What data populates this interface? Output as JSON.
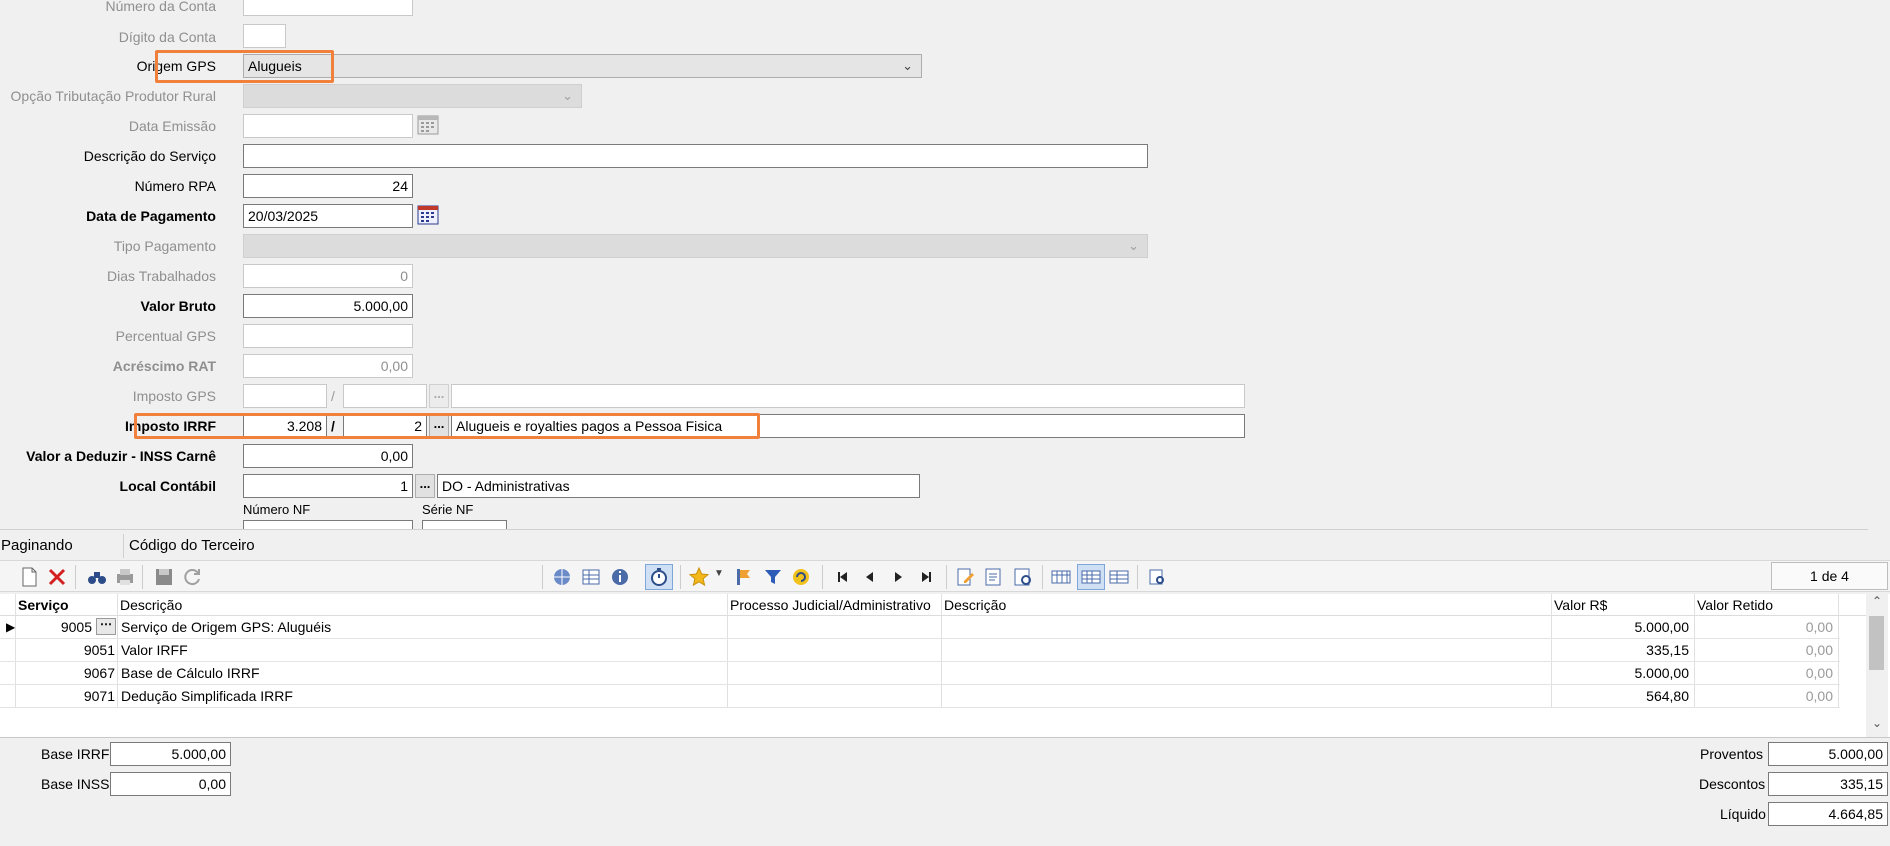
{
  "form": {
    "numero_conta_label": "Número da Conta",
    "digito_conta_label": "Dígito da Conta",
    "origem_gps_label": "Origem GPS",
    "origem_gps_value": "Alugueis",
    "opcao_tributacao_label": "Opção Tributação Produtor Rural",
    "data_emissao_label": "Data Emissão",
    "descricao_servico_label": "Descrição do Serviço",
    "numero_rpa_label": "Número RPA",
    "numero_rpa_value": "24",
    "data_pagamento_label": "Data de Pagamento",
    "data_pagamento_value": "20/03/2025",
    "tipo_pagamento_label": "Tipo Pagamento",
    "dias_trabalhados_label": "Dias Trabalhados",
    "dias_trabalhados_value": "0",
    "valor_bruto_label": "Valor Bruto",
    "valor_bruto_value": "5.000,00",
    "percentual_gps_label": "Percentual GPS",
    "acrescimo_rat_label": "Acréscimo RAT",
    "acrescimo_rat_value": "0,00",
    "imposto_gps_label": "Imposto GPS",
    "slash": "/",
    "imposto_irrf_label": "Imposto IRRF",
    "imposto_irrf_code": "3.208",
    "imposto_irrf_variation": "2",
    "imposto_irrf_desc": "Alugueis e royalties pagos a Pessoa Fisica",
    "valor_deduzir_label": "Valor a Deduzir - INSS Carnê",
    "valor_deduzir_value": "0,00",
    "local_contabil_label": "Local Contábil",
    "local_contabil_code": "1",
    "local_contabil_desc": "DO - Administrativas",
    "numero_nf_label": "Número NF",
    "serie_nf_label": "Série NF",
    "dots": "..."
  },
  "paging": {
    "label": "Paginando",
    "field": "Código do Terceiro",
    "counter": "1 de 4"
  },
  "grid": {
    "columns": [
      "Serviço",
      "Descrição",
      "Processo Judicial/Administrativo",
      "Descrição",
      "Valor R$",
      "Valor Retido"
    ],
    "rows": [
      {
        "servico": "9005",
        "descricao": "Serviço de Origem GPS: Aluguéis",
        "processo": "",
        "descricao2": "",
        "valor": "5.000,00",
        "retido": "0,00"
      },
      {
        "servico": "9051",
        "descricao": "Valor IRFF",
        "processo": "",
        "descricao2": "",
        "valor": "335,15",
        "retido": "0,00"
      },
      {
        "servico": "9067",
        "descricao": "Base de Cálculo IRRF",
        "processo": "",
        "descricao2": "",
        "valor": "5.000,00",
        "retido": "0,00"
      },
      {
        "servico": "9071",
        "descricao": "Dedução Simplificada IRRF",
        "processo": "",
        "descricao2": "",
        "valor": "564,80",
        "retido": "0,00"
      }
    ]
  },
  "totals": {
    "base_irrf_label": "Base IRRF",
    "base_irrf_value": "5.000,00",
    "base_inss_label": "Base INSS",
    "base_inss_value": "0,00",
    "proventos_label": "Proventos",
    "proventos_value": "5.000,00",
    "descontos_label": "Descontos",
    "descontos_value": "335,15",
    "liquido_label": "Líquido",
    "liquido_value": "4.664,85"
  },
  "colors": {
    "highlight": "#f0803c",
    "background": "#f0f0f0"
  }
}
